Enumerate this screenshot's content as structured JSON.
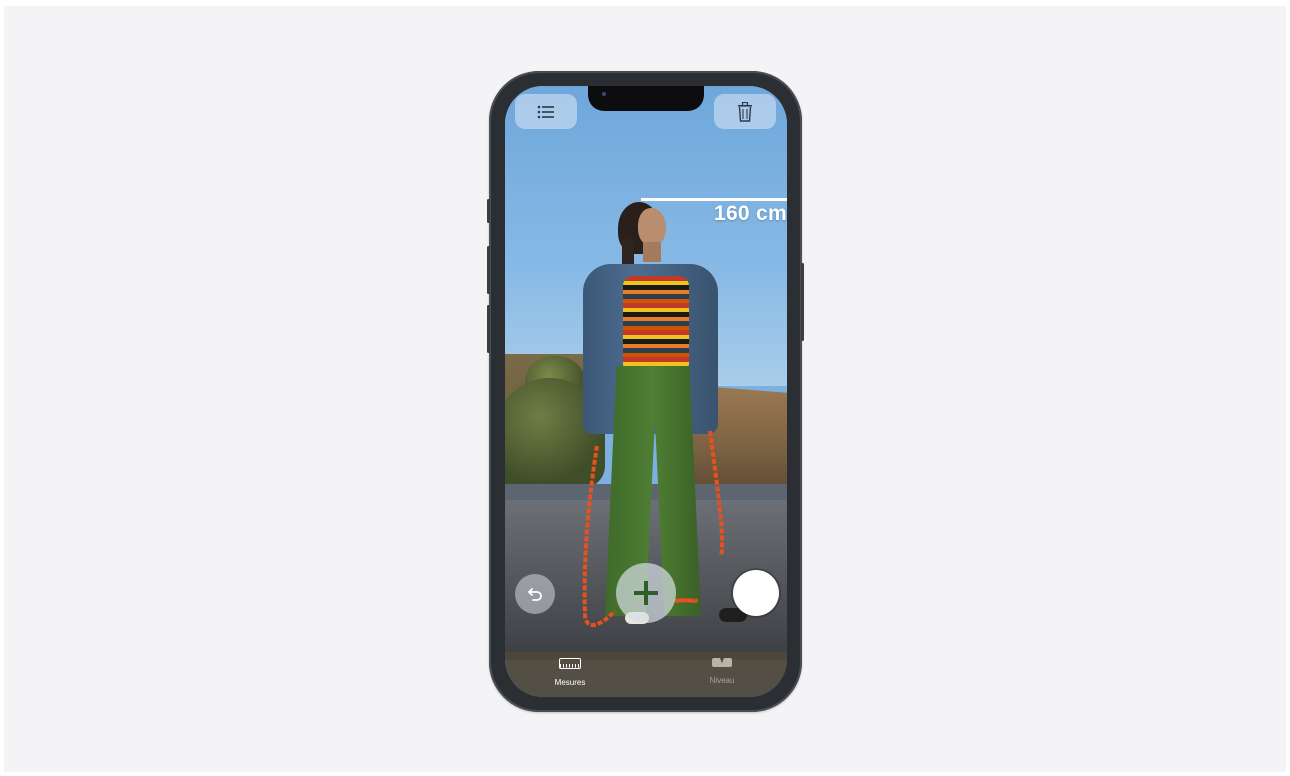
{
  "measurement": {
    "value_label": "160 cm"
  },
  "toolbar": {
    "list_icon": "list-icon",
    "trash_icon": "trash-icon"
  },
  "controls": {
    "undo_icon": "undo-icon",
    "add_icon": "plus-icon",
    "shutter_icon": "shutter-icon"
  },
  "tabs": [
    {
      "label": "Mesures",
      "icon": "ruler-icon",
      "selected": true
    },
    {
      "label": "Niveau",
      "icon": "level-icon",
      "selected": false
    }
  ],
  "colors": {
    "background": "#f4f4f6",
    "phone": "#2b2e33",
    "accent": "#ffffff",
    "add_symbol": "#2f5e2b"
  }
}
